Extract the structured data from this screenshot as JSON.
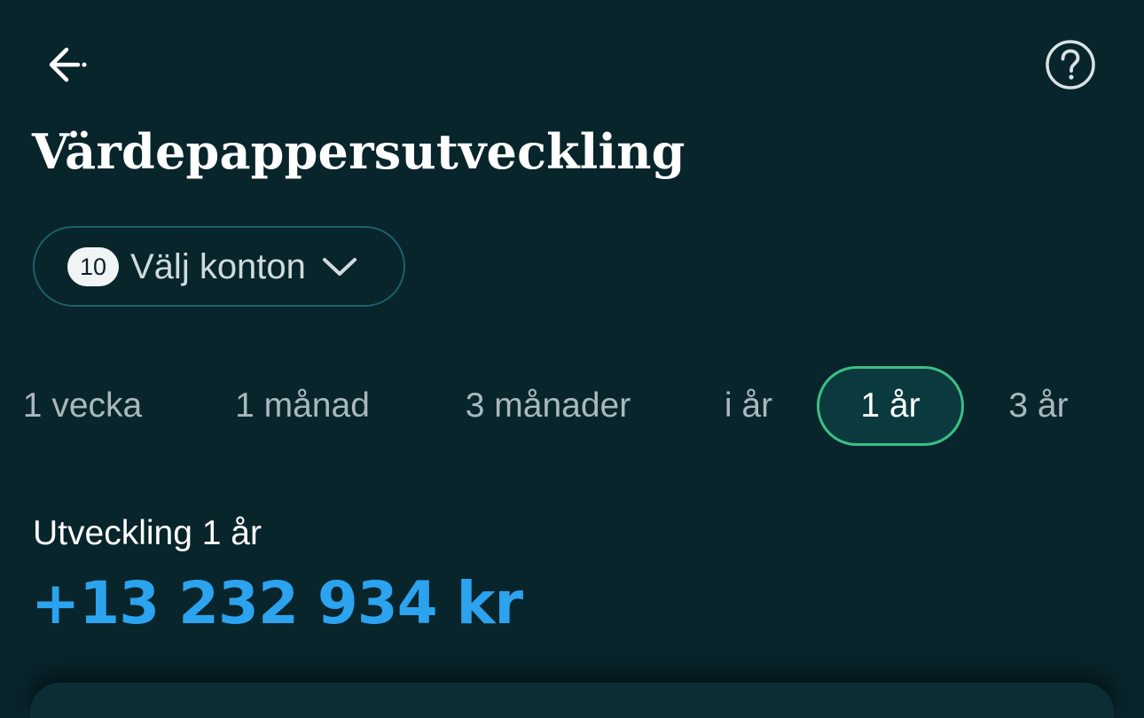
{
  "header": {
    "back_icon": "arrow-left-icon",
    "help_icon": "question-circle-icon"
  },
  "title": "Värdepappersutveckling",
  "accounts": {
    "count": "10",
    "label": "Välj konton",
    "chevron_icon": "chevron-down-icon"
  },
  "periods": [
    {
      "label": "1 vecka",
      "active": false
    },
    {
      "label": "1 månad",
      "active": false
    },
    {
      "label": "3 månader",
      "active": false
    },
    {
      "label": "i år",
      "active": false
    },
    {
      "label": "1 år",
      "active": true
    },
    {
      "label": "3 år",
      "active": false
    }
  ],
  "development": {
    "label": "Utveckling 1 år",
    "value": "+13 232 934 kr"
  },
  "colors": {
    "background": "#08252b",
    "value_blue": "#2ca3ef",
    "active_tab_border": "#3cbf85",
    "pill_border": "#1f5f6b"
  }
}
